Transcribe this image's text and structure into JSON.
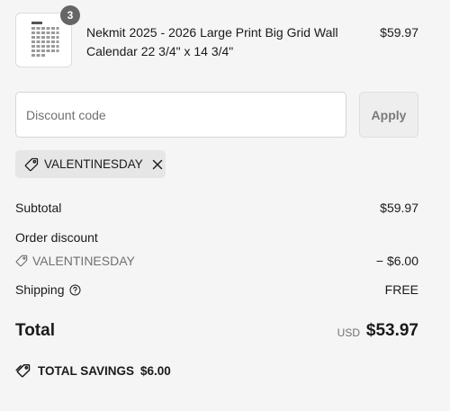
{
  "line_item": {
    "quantity": "3",
    "title": "Nekmit 2025 - 2026 Large Print Big Grid Wall Calendar 22 3/4\" x 14 3/4\"",
    "price": "$59.97",
    "thumbnail_icon": "calendar-product-thumbnail"
  },
  "discount": {
    "placeholder": "Discount code",
    "value": "",
    "apply_label": "Apply",
    "applied_code": "VALENTINESDAY",
    "tag_icon": "tag-icon",
    "remove_icon": "close-icon"
  },
  "summary": {
    "subtotal_label": "Subtotal",
    "subtotal_value": "$59.97",
    "order_discount_label": "Order discount",
    "order_discount_code": "VALENTINESDAY",
    "order_discount_value": "− $6.00",
    "shipping_label": "Shipping",
    "shipping_value": "FREE",
    "shipping_help_icon": "help-circle-icon"
  },
  "total": {
    "label": "Total",
    "currency": "USD",
    "value": "$53.97"
  },
  "savings": {
    "label": "TOTAL SAVINGS",
    "value": "$6.00",
    "icon": "savings-tag-icon"
  },
  "colors": {
    "background": "#f5f5f5",
    "text": "#1a1a1a",
    "muted": "#707070",
    "badge": "#666666",
    "chip": "#e6e6e6"
  }
}
